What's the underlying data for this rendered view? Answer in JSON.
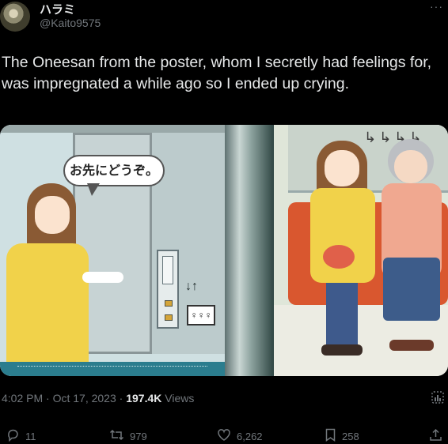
{
  "user": {
    "display_name": "ハラミ",
    "handle": "@Kaito9575",
    "more_glyph": "···"
  },
  "tweet": {
    "text": "The Oneesan from the poster, whom I secretly had feelings for, was impregnated a while ago so I ended up crying."
  },
  "media": {
    "speech_bubble": "お先にどうぞ。",
    "arrows": "↓↑",
    "people_glyph": "♀♀♀",
    "grab_glyph": "↳↳↳↳"
  },
  "meta": {
    "time": "4:02 PM",
    "date": "Oct 17, 2023",
    "separator": "·",
    "views_count": "197.4K",
    "views_label": "Views"
  },
  "actions": {
    "replies": "11",
    "retweets": "979",
    "likes": "6,262",
    "bookmarks": "258"
  },
  "icons": {
    "reply": "reply-icon",
    "retweet": "retweet-icon",
    "like": "heart-icon",
    "bookmark": "bookmark-icon",
    "share": "share-icon",
    "analytics": "analytics-icon"
  }
}
